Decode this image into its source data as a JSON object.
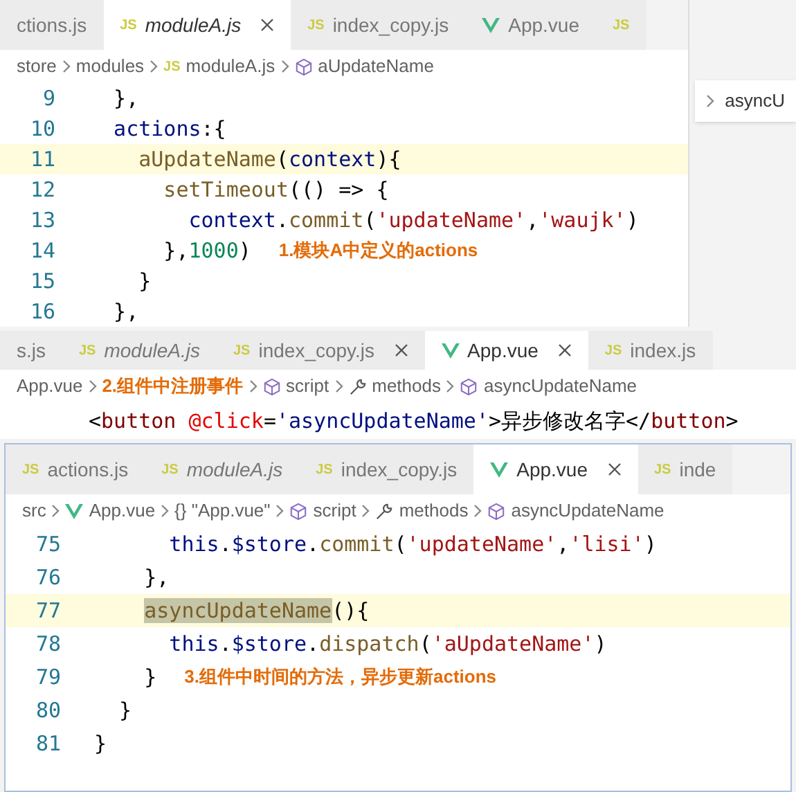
{
  "panels": [
    {
      "tabs": [
        {
          "kind": "js",
          "label": "ctions.js",
          "selected": false
        },
        {
          "kind": "js",
          "badge": "JS",
          "label": "moduleA.js",
          "selected": true,
          "preview": true,
          "close": true
        },
        {
          "kind": "js",
          "badge": "JS",
          "label": "index_copy.js",
          "selected": false
        },
        {
          "kind": "vue",
          "label": "App.vue",
          "selected": false
        },
        {
          "kind": "js",
          "badge": "JS",
          "selected": false
        }
      ],
      "breadcrumb": [
        {
          "kind": "plain",
          "label": "store"
        },
        {
          "kind": "plain",
          "label": "modules"
        },
        {
          "kind": "js",
          "badge": "JS",
          "label": "moduleA.js"
        },
        {
          "kind": "cube",
          "label": "aUpdateName"
        }
      ],
      "peek": {
        "text": "asyncU"
      },
      "lines": [
        {
          "number": "9",
          "current": false,
          "tokens": [
            {
              "kind": "punct",
              "text": "  },"
            }
          ]
        },
        {
          "number": "10",
          "current": false,
          "tokens": [
            {
              "kind": "var",
              "text": "  actions"
            },
            {
              "kind": "punct",
              "text": ":{"
            }
          ]
        },
        {
          "number": "11",
          "current": true,
          "tokens": [
            {
              "kind": "fn",
              "text": "    aUpdateName"
            },
            {
              "kind": "punct",
              "text": "("
            },
            {
              "kind": "var",
              "text": "context"
            },
            {
              "kind": "punct",
              "text": "){"
            }
          ]
        },
        {
          "number": "12",
          "current": false,
          "tokens": [
            {
              "kind": "fn",
              "text": "      setTimeout"
            },
            {
              "kind": "punct",
              "text": "(() => {"
            }
          ]
        },
        {
          "number": "13",
          "current": false,
          "tokens": [
            {
              "kind": "var",
              "text": "        context"
            },
            {
              "kind": "punct",
              "text": "."
            },
            {
              "kind": "fn",
              "text": "commit"
            },
            {
              "kind": "punct",
              "text": "("
            },
            {
              "kind": "str",
              "text": "'updateName'"
            },
            {
              "kind": "punct",
              "text": ","
            },
            {
              "kind": "str",
              "text": "'waujk'"
            },
            {
              "kind": "punct",
              "text": ")"
            }
          ]
        },
        {
          "number": "14",
          "current": false,
          "tokens": [
            {
              "kind": "punct",
              "text": "      },"
            },
            {
              "kind": "num",
              "text": "1000"
            },
            {
              "kind": "punct",
              "text": ")"
            }
          ],
          "note": "1.模块A中定义的actions"
        },
        {
          "number": "15",
          "current": false,
          "tokens": [
            {
              "kind": "punct",
              "text": "    }"
            }
          ]
        },
        {
          "number": "16",
          "current": false,
          "tokens": [
            {
              "kind": "punct",
              "text": "  },"
            }
          ]
        }
      ]
    },
    {
      "tabs": [
        {
          "kind": "js",
          "label": "s.js",
          "selected": false
        },
        {
          "kind": "js",
          "badge": "JS",
          "label": "moduleA.js",
          "selected": false,
          "preview": true
        },
        {
          "kind": "js",
          "badge": "JS",
          "label": "index_copy.js",
          "selected": false,
          "close": true
        },
        {
          "kind": "vue",
          "label": "App.vue",
          "selected": true,
          "close": true
        },
        {
          "kind": "js",
          "badge": "JS",
          "label": "index.js",
          "selected": false
        }
      ],
      "breadcrumb": [
        {
          "kind": "plain",
          "label": "App.vue"
        },
        {
          "kind": "note",
          "label": "2.组件中注册事件"
        },
        {
          "kind": "cube",
          "label": "script"
        },
        {
          "kind": "wrench",
          "label": "methods"
        },
        {
          "kind": "cube",
          "label": "asyncUpdateName"
        }
      ],
      "lines": [
        {
          "current": false,
          "tokens": [
            {
              "kind": "punct",
              "text": "<"
            },
            {
              "kind": "tag",
              "text": "button"
            },
            {
              "kind": "attr",
              "text": " @click"
            },
            {
              "kind": "punct",
              "text": "="
            },
            {
              "kind": "var",
              "text": "'asyncUpdateName'"
            },
            {
              "kind": "punct",
              "text": ">异步修改名字</"
            },
            {
              "kind": "tag",
              "text": "button"
            },
            {
              "kind": "punct",
              "text": ">"
            }
          ]
        }
      ]
    },
    {
      "tabs": [
        {
          "kind": "js",
          "badge": "JS",
          "label": "actions.js",
          "selected": false
        },
        {
          "kind": "js",
          "badge": "JS",
          "label": "moduleA.js",
          "selected": false,
          "preview": true
        },
        {
          "kind": "js",
          "badge": "JS",
          "label": "index_copy.js",
          "selected": false
        },
        {
          "kind": "vue",
          "label": "App.vue",
          "selected": true,
          "close": true
        },
        {
          "kind": "js",
          "badge": "JS",
          "label": "inde",
          "selected": false
        }
      ],
      "breadcrumb": [
        {
          "kind": "plain",
          "label": "src"
        },
        {
          "kind": "vue",
          "label": "App.vue"
        },
        {
          "kind": "braces",
          "label": "{} \"App.vue\""
        },
        {
          "kind": "cube",
          "label": "script"
        },
        {
          "kind": "wrench",
          "label": "methods"
        },
        {
          "kind": "cube",
          "label": "asyncUpdateName"
        }
      ],
      "lines": [
        {
          "number": "75",
          "current": false,
          "tokens": [
            {
              "kind": "var",
              "text": "      this"
            },
            {
              "kind": "punct",
              "text": "."
            },
            {
              "kind": "var",
              "text": "$store"
            },
            {
              "kind": "punct",
              "text": "."
            },
            {
              "kind": "fn",
              "text": "commit"
            },
            {
              "kind": "punct",
              "text": "("
            },
            {
              "kind": "str",
              "text": "'updateName'"
            },
            {
              "kind": "punct",
              "text": ","
            },
            {
              "kind": "str",
              "text": "'lisi'"
            },
            {
              "kind": "punct",
              "text": ")"
            }
          ]
        },
        {
          "number": "76",
          "current": false,
          "tokens": [
            {
              "kind": "punct",
              "text": "    },"
            }
          ]
        },
        {
          "number": "77",
          "current": true,
          "tokens": [
            {
              "kind": "match",
              "text": "    asyncUpdateName"
            },
            {
              "kind": "punct",
              "text": "(){"
            }
          ]
        },
        {
          "number": "78",
          "current": false,
          "tokens": [
            {
              "kind": "var",
              "text": "      this"
            },
            {
              "kind": "punct",
              "text": "."
            },
            {
              "kind": "var",
              "text": "$store"
            },
            {
              "kind": "punct",
              "text": "."
            },
            {
              "kind": "fn",
              "text": "dispatch"
            },
            {
              "kind": "punct",
              "text": "("
            },
            {
              "kind": "str",
              "text": "'aUpdateName'"
            },
            {
              "kind": "punct",
              "text": ")"
            }
          ]
        },
        {
          "number": "79",
          "current": false,
          "tokens": [
            {
              "kind": "punct",
              "text": "    }"
            }
          ],
          "note": "3.组件中时间的方法，异步更新actions"
        },
        {
          "number": "80",
          "current": false,
          "tokens": [
            {
              "kind": "punct",
              "text": "  }"
            }
          ]
        },
        {
          "number": "81",
          "current": false,
          "tokens": [
            {
              "kind": "punct",
              "text": "}"
            }
          ]
        }
      ]
    }
  ]
}
